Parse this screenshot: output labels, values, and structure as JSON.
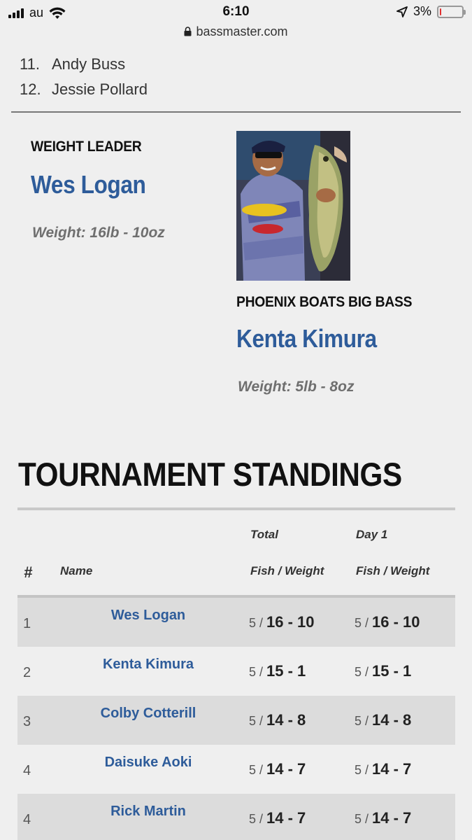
{
  "status_bar": {
    "carrier": "au",
    "time": "6:10",
    "battery_percent": "3%",
    "battery_level": 0.03
  },
  "url_bar": {
    "domain": "bassmaster.com"
  },
  "previous_list": [
    {
      "num": "11.",
      "name": "Andy Buss"
    },
    {
      "num": "12.",
      "name": "Jessie Pollard"
    }
  ],
  "weight_leader": {
    "label": "WEIGHT LEADER",
    "name": "Wes Logan",
    "weight": "Weight: 16lb - 10oz"
  },
  "big_bass": {
    "label": "PHOENIX BOATS BIG BASS",
    "name": "Kenta Kimura",
    "weight": "Weight: 5lb - 8oz"
  },
  "standings": {
    "title": "TOURNAMENT STANDINGS",
    "headers": {
      "rank": "#",
      "name": "Name",
      "total_top": "Total",
      "total_bottom": "Fish / Weight",
      "day1_top": "Day 1",
      "day1_bottom": "Fish / Weight"
    },
    "rows": [
      {
        "rank": "1",
        "name": "Wes Logan",
        "total_fish": "5 /",
        "total_weight": "16 - 10",
        "day1_fish": "5 /",
        "day1_weight": "16 - 10"
      },
      {
        "rank": "2",
        "name": "Kenta Kimura",
        "total_fish": "5 /",
        "total_weight": "15 - 1",
        "day1_fish": "5 /",
        "day1_weight": "15 - 1"
      },
      {
        "rank": "3",
        "name": "Colby Cotterill",
        "total_fish": "5 /",
        "total_weight": "14 - 8",
        "day1_fish": "5 /",
        "day1_weight": "14 - 8"
      },
      {
        "rank": "4",
        "name": "Daisuke Aoki",
        "total_fish": "5 /",
        "total_weight": "14 - 7",
        "day1_fish": "5 /",
        "day1_weight": "14 - 7"
      },
      {
        "rank": "4",
        "name": "Rick Martin",
        "total_fish": "5 /",
        "total_weight": "14 - 7",
        "day1_fish": "5 /",
        "day1_weight": "14 - 7"
      }
    ]
  },
  "colors": {
    "link_blue": "#2e5c9a",
    "background": "#efefef",
    "row_shade": "#dcdcdc"
  }
}
